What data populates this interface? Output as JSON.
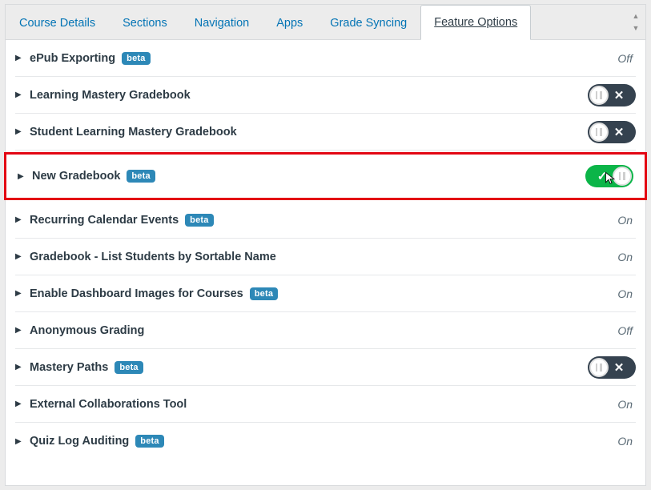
{
  "tabs": [
    {
      "id": "course-details",
      "label": "Course Details",
      "active": false
    },
    {
      "id": "sections",
      "label": "Sections",
      "active": false
    },
    {
      "id": "navigation",
      "label": "Navigation",
      "active": false
    },
    {
      "id": "apps",
      "label": "Apps",
      "active": false
    },
    {
      "id": "grade-syncing",
      "label": "Grade Syncing",
      "active": false
    },
    {
      "id": "feature-options",
      "label": "Feature Options",
      "active": true
    }
  ],
  "beta_label": "beta",
  "features": [
    {
      "id": "epub-exporting",
      "title": "ePub Exporting",
      "beta": true,
      "state": "text",
      "state_text": "Off",
      "highlighted": false
    },
    {
      "id": "learning-mastery-gradebook",
      "title": "Learning Mastery Gradebook",
      "beta": false,
      "state": "toggle-off",
      "highlighted": false
    },
    {
      "id": "student-learning-mastery",
      "title": "Student Learning Mastery Gradebook",
      "beta": false,
      "state": "toggle-off",
      "highlighted": false
    },
    {
      "id": "new-gradebook",
      "title": "New Gradebook",
      "beta": true,
      "state": "toggle-on",
      "highlighted": true
    },
    {
      "id": "recurring-calendar-events",
      "title": "Recurring Calendar Events",
      "beta": true,
      "state": "text",
      "state_text": "On",
      "highlighted": false
    },
    {
      "id": "gradebook-list-sortable-name",
      "title": "Gradebook - List Students by Sortable Name",
      "beta": false,
      "state": "text",
      "state_text": "On",
      "highlighted": false
    },
    {
      "id": "enable-dashboard-images",
      "title": "Enable Dashboard Images for Courses",
      "beta": true,
      "state": "text",
      "state_text": "On",
      "highlighted": false
    },
    {
      "id": "anonymous-grading",
      "title": "Anonymous Grading",
      "beta": false,
      "state": "text",
      "state_text": "Off",
      "highlighted": false
    },
    {
      "id": "mastery-paths",
      "title": "Mastery Paths",
      "beta": true,
      "state": "toggle-off",
      "highlighted": false
    },
    {
      "id": "external-collaborations-tool",
      "title": "External Collaborations Tool",
      "beta": false,
      "state": "text",
      "state_text": "On",
      "highlighted": false
    },
    {
      "id": "quiz-log-auditing",
      "title": "Quiz Log Auditing",
      "beta": true,
      "state": "text",
      "state_text": "On",
      "highlighted": false
    }
  ],
  "colors": {
    "highlight": "#e30613",
    "link": "#0374b5",
    "toggle_off_bg": "#35424f",
    "toggle_on_bg": "#0bb548",
    "beta_bg": "#2d88b7"
  }
}
